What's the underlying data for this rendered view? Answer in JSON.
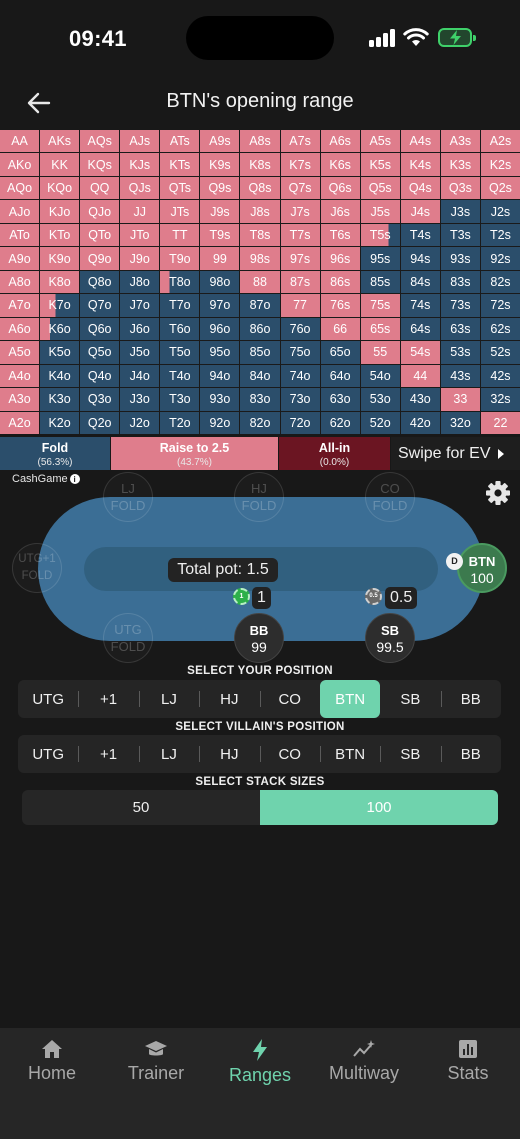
{
  "status_bar": {
    "time": "09:41"
  },
  "header": {
    "title": "BTN's opening range"
  },
  "range_grid": {
    "colors": {
      "raise": "#df7d8c",
      "fold": "#2b4e6b"
    },
    "rows": [
      [
        "AA",
        "AKs",
        "AQs",
        "AJs",
        "ATs",
        "A9s",
        "A8s",
        "A7s",
        "A6s",
        "A5s",
        "A4s",
        "A3s",
        "A2s"
      ],
      [
        "AKo",
        "KK",
        "KQs",
        "KJs",
        "KTs",
        "K9s",
        "K8s",
        "K7s",
        "K6s",
        "K5s",
        "K4s",
        "K3s",
        "K2s"
      ],
      [
        "AQo",
        "KQo",
        "QQ",
        "QJs",
        "QTs",
        "Q9s",
        "Q8s",
        "Q7s",
        "Q6s",
        "Q5s",
        "Q4s",
        "Q3s",
        "Q2s"
      ],
      [
        "AJo",
        "KJo",
        "QJo",
        "JJ",
        "JTs",
        "J9s",
        "J8s",
        "J7s",
        "J6s",
        "J5s",
        "J4s",
        "J3s",
        "J2s"
      ],
      [
        "ATo",
        "KTo",
        "QTo",
        "JTo",
        "TT",
        "T9s",
        "T8s",
        "T7s",
        "T6s",
        "T5s",
        "T4s",
        "T3s",
        "T2s"
      ],
      [
        "A9o",
        "K9o",
        "Q9o",
        "J9o",
        "T9o",
        "99",
        "98s",
        "97s",
        "96s",
        "95s",
        "94s",
        "93s",
        "92s"
      ],
      [
        "A8o",
        "K8o",
        "Q8o",
        "J8o",
        "T8o",
        "98o",
        "88",
        "87s",
        "86s",
        "85s",
        "84s",
        "83s",
        "82s"
      ],
      [
        "A7o",
        "K7o",
        "Q7o",
        "J7o",
        "T7o",
        "97o",
        "87o",
        "77",
        "76s",
        "75s",
        "74s",
        "73s",
        "72s"
      ],
      [
        "A6o",
        "K6o",
        "Q6o",
        "J6o",
        "T6o",
        "96o",
        "86o",
        "76o",
        "66",
        "65s",
        "64s",
        "63s",
        "62s"
      ],
      [
        "A5o",
        "K5o",
        "Q5o",
        "J5o",
        "T5o",
        "95o",
        "85o",
        "75o",
        "65o",
        "55",
        "54s",
        "53s",
        "52s"
      ],
      [
        "A4o",
        "K4o",
        "Q4o",
        "J4o",
        "T4o",
        "94o",
        "84o",
        "74o",
        "64o",
        "54o",
        "44",
        "43s",
        "42s"
      ],
      [
        "A3o",
        "K3o",
        "Q3o",
        "J3o",
        "T3o",
        "93o",
        "83o",
        "73o",
        "63o",
        "53o",
        "43o",
        "33",
        "32s"
      ],
      [
        "A2o",
        "K2o",
        "Q2o",
        "J2o",
        "T2o",
        "92o",
        "82o",
        "72o",
        "62o",
        "52o",
        "42o",
        "32o",
        "22"
      ]
    ],
    "raise_fraction": [
      [
        1,
        1,
        1,
        1,
        1,
        1,
        1,
        1,
        1,
        1,
        1,
        1,
        1
      ],
      [
        1,
        1,
        1,
        1,
        1,
        1,
        1,
        1,
        1,
        1,
        1,
        1,
        1
      ],
      [
        1,
        1,
        1,
        1,
        1,
        1,
        1,
        1,
        1,
        1,
        1,
        1,
        1
      ],
      [
        1,
        1,
        1,
        1,
        1,
        1,
        1,
        1,
        1,
        1,
        1,
        0,
        0
      ],
      [
        1,
        1,
        1,
        1,
        1,
        1,
        1,
        1,
        1,
        0.7,
        0,
        0,
        0
      ],
      [
        1,
        1,
        1,
        1,
        1,
        1,
        1,
        1,
        1,
        0,
        0,
        0,
        0
      ],
      [
        1,
        1,
        0,
        0,
        0.25,
        0,
        1,
        1,
        1,
        0,
        0,
        0,
        0
      ],
      [
        1,
        0.4,
        0,
        0,
        0,
        0,
        0,
        1,
        1,
        1,
        0,
        0,
        0
      ],
      [
        1,
        0.25,
        0,
        0,
        0,
        0,
        0,
        0,
        1,
        1,
        0,
        0,
        0
      ],
      [
        1,
        0,
        0,
        0,
        0,
        0,
        0,
        0,
        0,
        1,
        1,
        0,
        0
      ],
      [
        1,
        0,
        0,
        0,
        0,
        0,
        0,
        0,
        0,
        0,
        1,
        0,
        0
      ],
      [
        1,
        0,
        0,
        0,
        0,
        0,
        0,
        0,
        0,
        0,
        0,
        1,
        0
      ],
      [
        1,
        0,
        0,
        0,
        0,
        0,
        0,
        0,
        0,
        0,
        0,
        0,
        1
      ]
    ]
  },
  "legend": {
    "fold": {
      "label": "Fold",
      "pct": "(56.3%)"
    },
    "raise": {
      "label": "Raise to 2.5",
      "pct": "(43.7%)"
    },
    "allin": {
      "label": "All-in",
      "pct": "(0.0%)"
    },
    "swipe": "Swipe for EV"
  },
  "game_label": "CashGame",
  "table": {
    "pot": "Total pot: 1.5",
    "seats": {
      "lj": {
        "name": "LJ",
        "status": "FOLD"
      },
      "hj": {
        "name": "HJ",
        "status": "FOLD"
      },
      "co": {
        "name": "CO",
        "status": "FOLD"
      },
      "utg1": {
        "name": "UTG+1",
        "status": "FOLD"
      },
      "utg": {
        "name": "UTG",
        "status": "FOLD"
      },
      "bb": {
        "name": "BB",
        "stack": "99"
      },
      "sb": {
        "name": "SB",
        "stack": "99.5"
      },
      "btn": {
        "name": "BTN",
        "stack": "100"
      }
    },
    "dealer": "D",
    "bb_bet": "1",
    "bb_chip": "1",
    "sb_bet": "0.5",
    "sb_chip": "0.5"
  },
  "position_label": "SELECT YOUR POSITION",
  "villain_label": "SELECT VILLAIN'S POSITION",
  "stack_label": "SELECT STACK SIZES",
  "positions": [
    "UTG",
    "+1",
    "LJ",
    "HJ",
    "CO",
    "BTN",
    "SB",
    "BB"
  ],
  "hero_selected": 5,
  "villain_positions": [
    "UTG",
    "+1",
    "LJ",
    "HJ",
    "CO",
    "BTN",
    "SB",
    "BB"
  ],
  "stacks": [
    "50",
    "100"
  ],
  "stack_selected": 1,
  "nav": {
    "home": "Home",
    "trainer": "Trainer",
    "ranges": "Ranges",
    "multiway": "Multiway",
    "stats": "Stats"
  }
}
